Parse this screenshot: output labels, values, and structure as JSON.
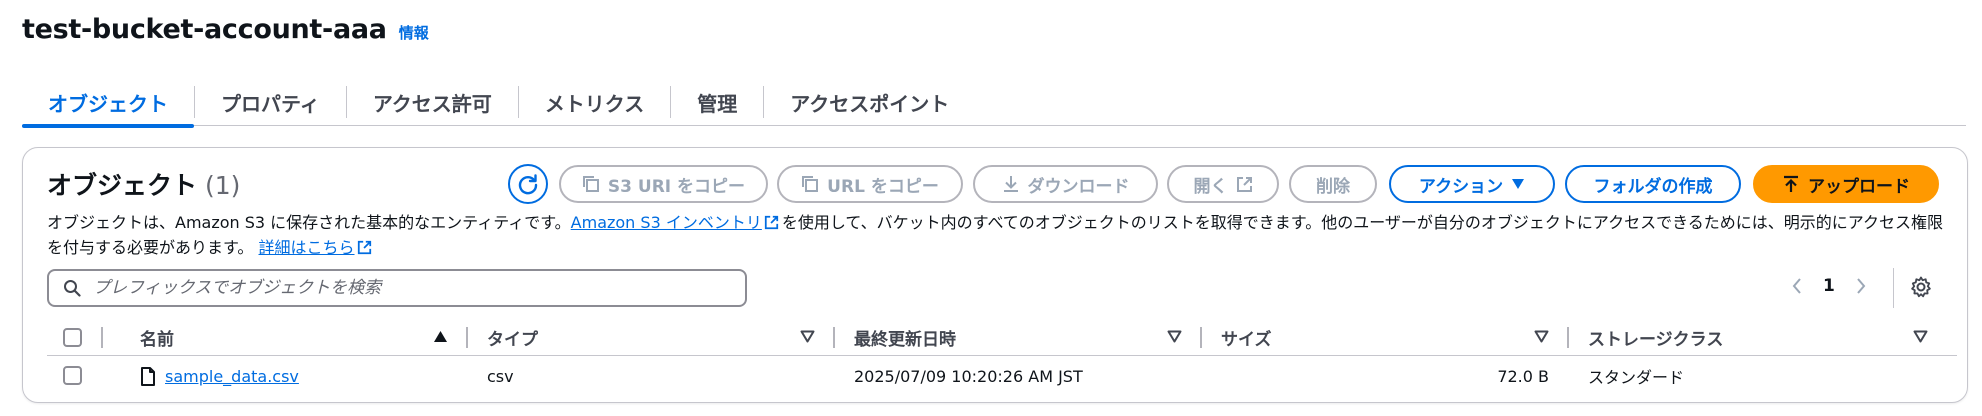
{
  "header": {
    "title": "test-bucket-account-aaa",
    "info_link": "情報"
  },
  "tabs": [
    {
      "label": "オブジェクト",
      "active": true
    },
    {
      "label": "プロパティ",
      "active": false
    },
    {
      "label": "アクセス許可",
      "active": false
    },
    {
      "label": "メトリクス",
      "active": false
    },
    {
      "label": "管理",
      "active": false
    },
    {
      "label": "アクセスポイント",
      "active": false
    }
  ],
  "objects_panel": {
    "title": "オブジェクト",
    "count": "(1)",
    "buttons": {
      "copy_s3_uri": "S3 URI をコピー",
      "copy_url": "URL をコピー",
      "download": "ダウンロード",
      "open": "開く",
      "delete": "削除",
      "actions": "アクション",
      "create_folder": "フォルダの作成",
      "upload": "アップロード"
    },
    "description": {
      "part1": "オブジェクトは、Amazon S3 に保存された基本的なエンティティです。",
      "inventory_link": "Amazon S3 インベントリ",
      "part2": "を使用して、バケット内のすべてのオブジェクトのリストを取得できます。他のユーザーが自分のオブジェクトにアクセスできるためには、明示的にアクセス権限を付与する必要があります。",
      "details_link": "詳細はこちら"
    },
    "search": {
      "placeholder": "プレフィックスでオブジェクトを検索",
      "value": ""
    },
    "pagination": {
      "current_page": "1"
    },
    "table": {
      "columns": [
        "名前",
        "タイプ",
        "最終更新日時",
        "サイズ",
        "ストレージクラス"
      ],
      "sort": {
        "column": "名前",
        "direction": "ascending"
      },
      "rows": [
        {
          "name": "sample_data.csv",
          "type": "csv",
          "last_modified": "2025/07/09 10:20:26 AM JST",
          "size": "72.0 B",
          "storage_class": "スタンダード"
        }
      ]
    }
  },
  "colors": {
    "accent": "#006ce0",
    "primary_button": "#ff9900",
    "disabled": "#9ba7b6",
    "border": "#c6c6cd"
  },
  "icons": [
    "refresh-icon",
    "copy-icon",
    "download-icon",
    "external-link-icon",
    "caret-down-icon",
    "upload-icon",
    "search-icon",
    "chevron-left-icon",
    "chevron-right-icon",
    "settings-icon",
    "sort-ascending-icon",
    "sort-icon",
    "file-icon"
  ]
}
